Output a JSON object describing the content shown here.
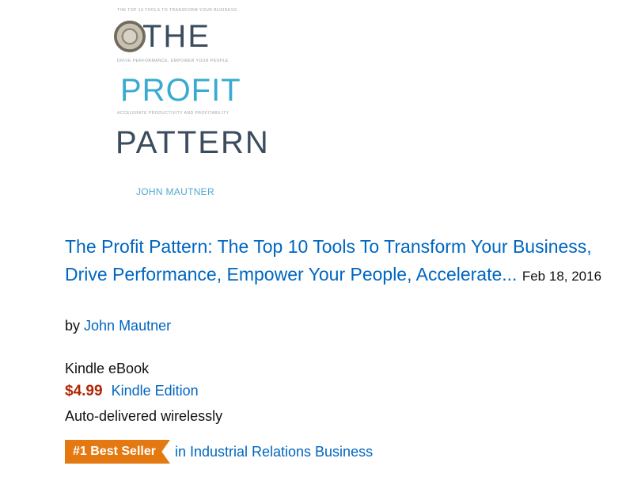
{
  "cover": {
    "tagline_top": "THE TOP 10 TOOLS TO TRANSFORM YOUR BUSINESS",
    "word_the": "THE",
    "tagline_mid": "DRIVE PERFORMANCE, EMPOWER YOUR PEOPLE",
    "word_profit": "PROFIT",
    "tagline_low": "ACCELERATE PRODUCTIVITY AND PROFITABILITY",
    "word_pattern": "PATTERN",
    "author": "JOHN MAUTNER"
  },
  "product": {
    "title": "The Profit Pattern: The Top 10 Tools To Transform Your Business, Drive Performance, Empower Your People, Accelerate...",
    "date": "Feb 18, 2016",
    "by_prefix": "by",
    "author": "John Mautner",
    "format": "Kindle eBook",
    "price": "$4.99",
    "edition": "Kindle Edition",
    "delivery": "Auto-delivered wirelessly",
    "badge": "#1 Best Seller",
    "badge_category": "in Industrial Relations Business"
  },
  "colors": {
    "link": "#0066c0",
    "price": "#b12704",
    "badge": "#e47911"
  }
}
